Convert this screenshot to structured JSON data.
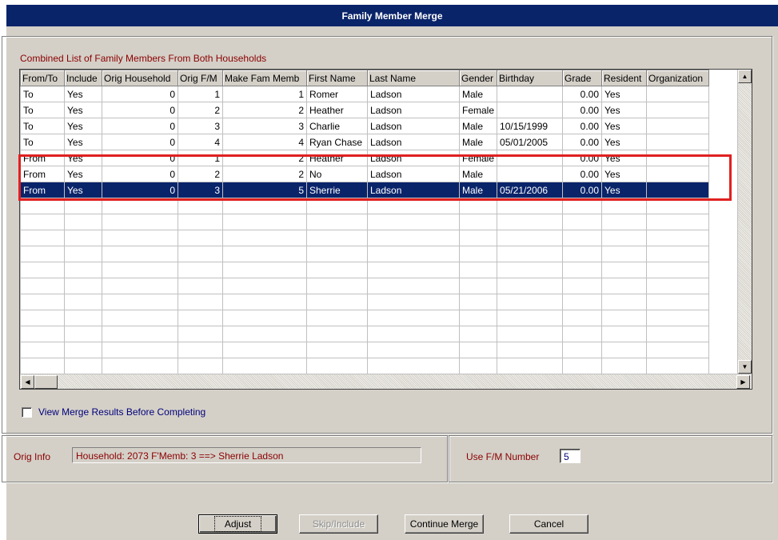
{
  "window": {
    "title": "Family Member Merge"
  },
  "grid": {
    "caption": "Combined List of Family Members From Both Households",
    "columns": [
      "From/To",
      "Include",
      "Orig Household",
      "Orig F/M",
      "Make Fam Memb",
      "First Name",
      "Last Name",
      "Gender",
      "Birthday",
      "Grade",
      "Resident",
      "Organization"
    ],
    "rows": [
      [
        "To",
        "Yes",
        "0",
        "1",
        "1",
        "Romer",
        "Ladson",
        "Male",
        "",
        "0.00",
        "Yes",
        ""
      ],
      [
        "To",
        "Yes",
        "0",
        "2",
        "2",
        "Heather",
        "Ladson",
        "Female",
        "",
        "0.00",
        "Yes",
        ""
      ],
      [
        "To",
        "Yes",
        "0",
        "3",
        "3",
        "Charlie",
        "Ladson",
        "Male",
        "10/15/1999",
        "0.00",
        "Yes",
        ""
      ],
      [
        "To",
        "Yes",
        "0",
        "4",
        "4",
        "Ryan Chase",
        "Ladson",
        "Male",
        "05/01/2005",
        "0.00",
        "Yes",
        ""
      ],
      [
        "From",
        "Yes",
        "0",
        "1",
        "2",
        "Heather",
        "Ladson",
        "Female",
        "",
        "0.00",
        "Yes",
        ""
      ],
      [
        "From",
        "Yes",
        "0",
        "2",
        "2",
        "No",
        "Ladson",
        "Male",
        "",
        "0.00",
        "Yes",
        ""
      ],
      [
        "From",
        "Yes",
        "0",
        "3",
        "5",
        "Sherrie",
        "Ladson",
        "Male",
        "05/21/2006",
        "0.00",
        "Yes",
        ""
      ]
    ],
    "selected_row": 6
  },
  "options": {
    "view_merge_results_label": "View Merge Results Before Completing",
    "view_merge_results_checked": false
  },
  "orig_info": {
    "label": "Orig Info",
    "value": "Household: 2073  F'Memb: 3 ==> Sherrie Ladson"
  },
  "fm_number": {
    "label": "Use F/M Number",
    "value": "5"
  },
  "buttons": {
    "adjust": "Adjust",
    "skip_include": "Skip/Include",
    "continue_merge": "Continue Merge",
    "cancel": "Cancel"
  },
  "colors": {
    "title_bar": "#0a246a",
    "selection": "#0a246a",
    "highlight_box": "#e02020",
    "label_text": "#8b0000"
  }
}
